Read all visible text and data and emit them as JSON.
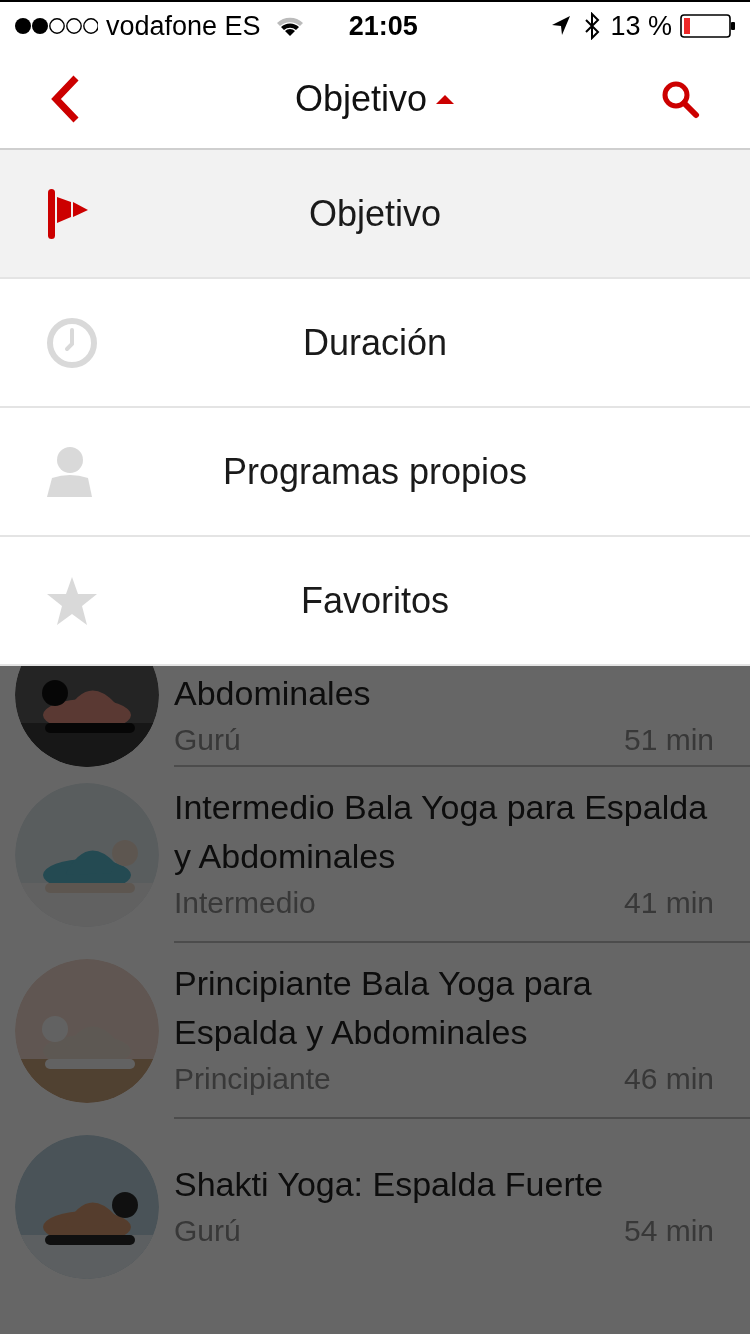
{
  "status_bar": {
    "carrier": "vodafone ES",
    "time": "21:05",
    "battery": "13 %"
  },
  "nav_bar": {
    "title": "Objetivo",
    "expanded": true
  },
  "menu": [
    {
      "label": "Objetivo",
      "kind": "flag",
      "selected": true
    },
    {
      "label": "Duración",
      "kind": "clock",
      "selected": false
    },
    {
      "label": "Programas propios",
      "kind": "person",
      "selected": false
    },
    {
      "label": "Favoritos",
      "kind": "star",
      "selected": false
    }
  ],
  "programs": [
    {
      "title": "Abdominales",
      "level": "Gurú",
      "duration": "51 min",
      "kind": "picture"
    },
    {
      "title": "Intermedio Bala Yoga para Espalda y Abdominales",
      "level": "Intermedio",
      "duration": "41 min",
      "kind": "picture"
    },
    {
      "title": "Principiante Bala Yoga para Espalda y Abdominales",
      "level": "Principiante",
      "duration": "46 min",
      "kind": "picture"
    },
    {
      "title": "Shakti Yoga: Espalda Fuerte",
      "level": "Gurú",
      "duration": "54 min",
      "kind": "picture"
    }
  ]
}
